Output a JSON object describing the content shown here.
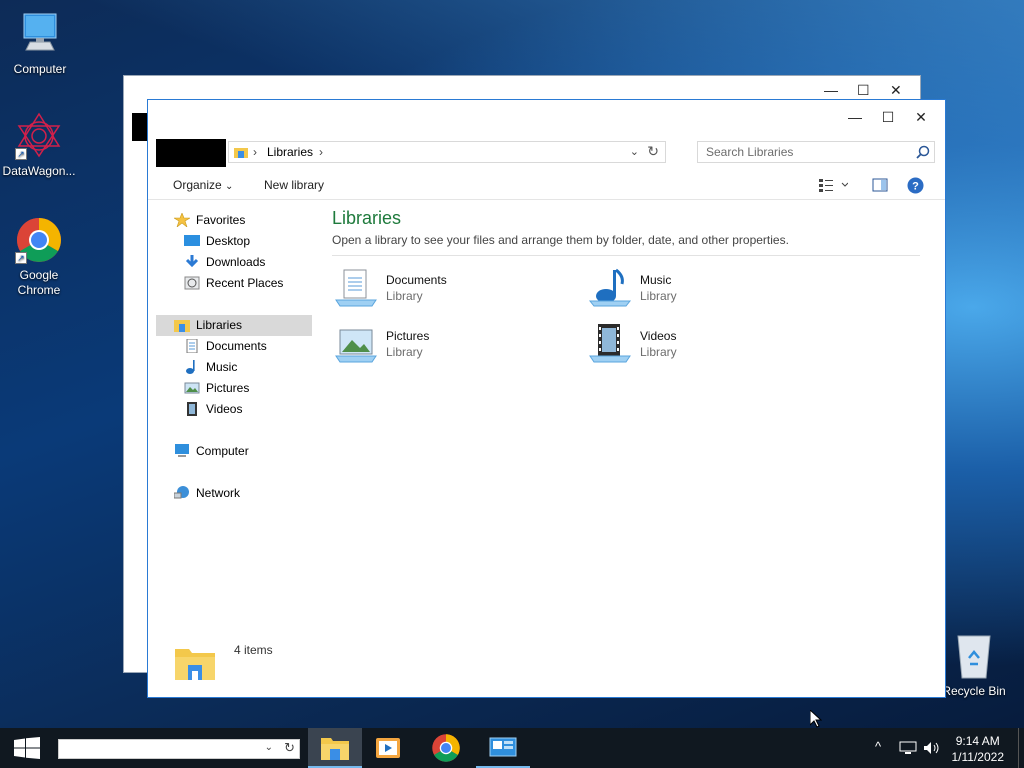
{
  "desktop": {
    "icons": [
      {
        "label": "Computer"
      },
      {
        "label": "DataWagon..."
      },
      {
        "label": "Google Chrome"
      },
      {
        "label": "Recycle Bin"
      }
    ]
  },
  "explorer": {
    "breadcrumb": [
      "Libraries"
    ],
    "search_placeholder": "Search Libraries",
    "commands": {
      "organize": "Organize",
      "new_library": "New library"
    },
    "nav": {
      "favorites": "Favorites",
      "favorite_items": [
        "Desktop",
        "Downloads",
        "Recent Places"
      ],
      "libraries": "Libraries",
      "library_items": [
        "Documents",
        "Music",
        "Pictures",
        "Videos"
      ],
      "computer": "Computer",
      "network": "Network"
    },
    "content": {
      "title": "Libraries",
      "subtitle": "Open a library to see your files and arrange them by folder, date, and other properties.",
      "libraries": [
        {
          "name": "Documents",
          "kind": "Library",
          "icon": "documents-library-icon"
        },
        {
          "name": "Music",
          "kind": "Library",
          "icon": "music-library-icon"
        },
        {
          "name": "Pictures",
          "kind": "Library",
          "icon": "pictures-library-icon"
        },
        {
          "name": "Videos",
          "kind": "Library",
          "icon": "videos-library-icon"
        }
      ]
    },
    "status": {
      "item_count": "4 items"
    }
  },
  "taskbar": {
    "clock_time": "9:14 AM",
    "clock_date": "1/11/2022"
  },
  "colors": {
    "accent": "#2a7ad4",
    "title_green": "#1e7a3c",
    "taskbar": "#101820"
  }
}
